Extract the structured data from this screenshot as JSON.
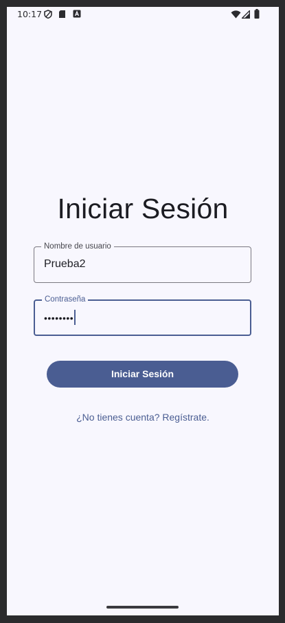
{
  "status_bar": {
    "time": "10:17",
    "left_icons": [
      "shield-icon",
      "sd-card-icon",
      "keyboard-a-icon"
    ],
    "right_icons": [
      "wifi-icon",
      "cell-signal-icon",
      "battery-icon"
    ]
  },
  "screen": {
    "title": "Iniciar Sesión",
    "username": {
      "label": "Nombre de usuario",
      "value": "Prueba2"
    },
    "password": {
      "label": "Contraseña",
      "masked_value": "••••••••"
    },
    "login_button": "Iniciar Sesión",
    "register_link": "¿No tienes cuenta? Regístrate."
  },
  "colors": {
    "background": "#f8f7fe",
    "primary": "#4a5d92",
    "text": "#1c1c22",
    "outline": "#7a7880"
  }
}
